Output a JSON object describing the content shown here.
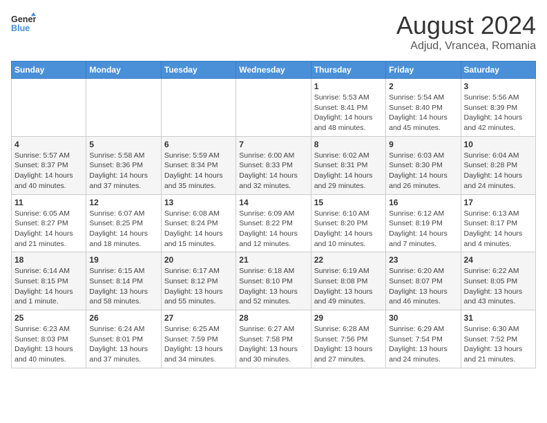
{
  "header": {
    "logo_line1": "General",
    "logo_line2": "Blue",
    "main_title": "August 2024",
    "subtitle": "Adjud, Vrancea, Romania"
  },
  "weekdays": [
    "Sunday",
    "Monday",
    "Tuesday",
    "Wednesday",
    "Thursday",
    "Friday",
    "Saturday"
  ],
  "weeks": [
    [
      {
        "day": "",
        "info": ""
      },
      {
        "day": "",
        "info": ""
      },
      {
        "day": "",
        "info": ""
      },
      {
        "day": "",
        "info": ""
      },
      {
        "day": "1",
        "info": "Sunrise: 5:53 AM\nSunset: 8:41 PM\nDaylight: 14 hours and 48 minutes."
      },
      {
        "day": "2",
        "info": "Sunrise: 5:54 AM\nSunset: 8:40 PM\nDaylight: 14 hours and 45 minutes."
      },
      {
        "day": "3",
        "info": "Sunrise: 5:56 AM\nSunset: 8:39 PM\nDaylight: 14 hours and 42 minutes."
      }
    ],
    [
      {
        "day": "4",
        "info": "Sunrise: 5:57 AM\nSunset: 8:37 PM\nDaylight: 14 hours and 40 minutes."
      },
      {
        "day": "5",
        "info": "Sunrise: 5:58 AM\nSunset: 8:36 PM\nDaylight: 14 hours and 37 minutes."
      },
      {
        "day": "6",
        "info": "Sunrise: 5:59 AM\nSunset: 8:34 PM\nDaylight: 14 hours and 35 minutes."
      },
      {
        "day": "7",
        "info": "Sunrise: 6:00 AM\nSunset: 8:33 PM\nDaylight: 14 hours and 32 minutes."
      },
      {
        "day": "8",
        "info": "Sunrise: 6:02 AM\nSunset: 8:31 PM\nDaylight: 14 hours and 29 minutes."
      },
      {
        "day": "9",
        "info": "Sunrise: 6:03 AM\nSunset: 8:30 PM\nDaylight: 14 hours and 26 minutes."
      },
      {
        "day": "10",
        "info": "Sunrise: 6:04 AM\nSunset: 8:28 PM\nDaylight: 14 hours and 24 minutes."
      }
    ],
    [
      {
        "day": "11",
        "info": "Sunrise: 6:05 AM\nSunset: 8:27 PM\nDaylight: 14 hours and 21 minutes."
      },
      {
        "day": "12",
        "info": "Sunrise: 6:07 AM\nSunset: 8:25 PM\nDaylight: 14 hours and 18 minutes."
      },
      {
        "day": "13",
        "info": "Sunrise: 6:08 AM\nSunset: 8:24 PM\nDaylight: 14 hours and 15 minutes."
      },
      {
        "day": "14",
        "info": "Sunrise: 6:09 AM\nSunset: 8:22 PM\nDaylight: 14 hours and 12 minutes."
      },
      {
        "day": "15",
        "info": "Sunrise: 6:10 AM\nSunset: 8:20 PM\nDaylight: 14 hours and 10 minutes."
      },
      {
        "day": "16",
        "info": "Sunrise: 6:12 AM\nSunset: 8:19 PM\nDaylight: 14 hours and 7 minutes."
      },
      {
        "day": "17",
        "info": "Sunrise: 6:13 AM\nSunset: 8:17 PM\nDaylight: 14 hours and 4 minutes."
      }
    ],
    [
      {
        "day": "18",
        "info": "Sunrise: 6:14 AM\nSunset: 8:15 PM\nDaylight: 14 hours and 1 minute."
      },
      {
        "day": "19",
        "info": "Sunrise: 6:15 AM\nSunset: 8:14 PM\nDaylight: 13 hours and 58 minutes."
      },
      {
        "day": "20",
        "info": "Sunrise: 6:17 AM\nSunset: 8:12 PM\nDaylight: 13 hours and 55 minutes."
      },
      {
        "day": "21",
        "info": "Sunrise: 6:18 AM\nSunset: 8:10 PM\nDaylight: 13 hours and 52 minutes."
      },
      {
        "day": "22",
        "info": "Sunrise: 6:19 AM\nSunset: 8:08 PM\nDaylight: 13 hours and 49 minutes."
      },
      {
        "day": "23",
        "info": "Sunrise: 6:20 AM\nSunset: 8:07 PM\nDaylight: 13 hours and 46 minutes."
      },
      {
        "day": "24",
        "info": "Sunrise: 6:22 AM\nSunset: 8:05 PM\nDaylight: 13 hours and 43 minutes."
      }
    ],
    [
      {
        "day": "25",
        "info": "Sunrise: 6:23 AM\nSunset: 8:03 PM\nDaylight: 13 hours and 40 minutes."
      },
      {
        "day": "26",
        "info": "Sunrise: 6:24 AM\nSunset: 8:01 PM\nDaylight: 13 hours and 37 minutes."
      },
      {
        "day": "27",
        "info": "Sunrise: 6:25 AM\nSunset: 7:59 PM\nDaylight: 13 hours and 34 minutes."
      },
      {
        "day": "28",
        "info": "Sunrise: 6:27 AM\nSunset: 7:58 PM\nDaylight: 13 hours and 30 minutes."
      },
      {
        "day": "29",
        "info": "Sunrise: 6:28 AM\nSunset: 7:56 PM\nDaylight: 13 hours and 27 minutes."
      },
      {
        "day": "30",
        "info": "Sunrise: 6:29 AM\nSunset: 7:54 PM\nDaylight: 13 hours and 24 minutes."
      },
      {
        "day": "31",
        "info": "Sunrise: 6:30 AM\nSunset: 7:52 PM\nDaylight: 13 hours and 21 minutes."
      }
    ]
  ]
}
